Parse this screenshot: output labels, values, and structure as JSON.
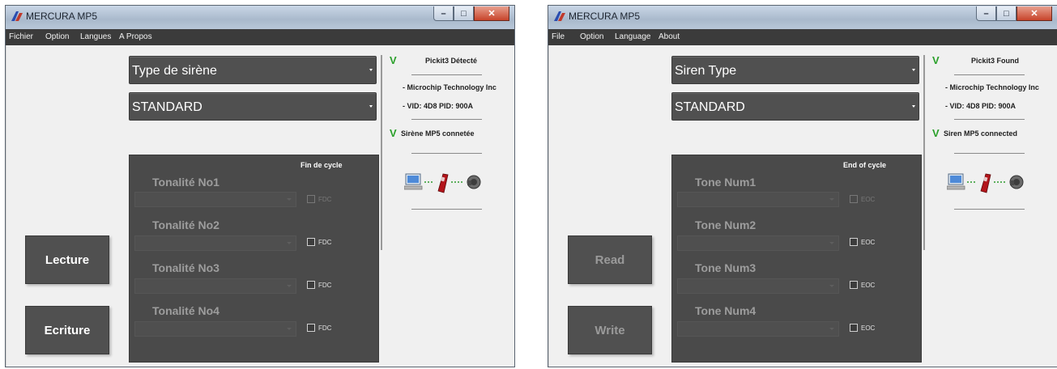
{
  "windows": [
    {
      "title": "MERCURA MP5",
      "menu": [
        "Fichier",
        "Option",
        "Langues",
        "A Propos"
      ],
      "siren_type": "Type de sirène",
      "siren_model": "STANDARD",
      "end_of_cycle_header": "Fin de cycle",
      "tones": [
        {
          "label": "Tonalité No1",
          "check_label": "FDC"
        },
        {
          "label": "Tonalité No2",
          "check_label": "FDC"
        },
        {
          "label": "Tonalité No3",
          "check_label": "FDC"
        },
        {
          "label": "Tonalité No4",
          "check_label": "FDC"
        }
      ],
      "read_button": "Lecture",
      "write_button": "Ecriture",
      "buttons_enabled": true,
      "status": {
        "check_mark": "V",
        "pickit": "Pickit3 Détecté",
        "manufacturer": "- Microchip Technology Inc",
        "vid_pid": "- VID: 4D8 PID: 900A",
        "siren": "Sirène MP5 connetée"
      }
    },
    {
      "title": "MERCURA MP5",
      "menu": [
        "File",
        "Option",
        "Language",
        "About"
      ],
      "siren_type": "Siren Type",
      "siren_model": "STANDARD",
      "end_of_cycle_header": "End of cycle",
      "tones": [
        {
          "label": "Tone Num1",
          "check_label": "EOC"
        },
        {
          "label": "Tone Num2",
          "check_label": "EOC"
        },
        {
          "label": "Tone Num3",
          "check_label": "EOC"
        },
        {
          "label": "Tone Num4",
          "check_label": "EOC"
        }
      ],
      "read_button": "Read",
      "write_button": "Write",
      "buttons_enabled": false,
      "status": {
        "check_mark": "V",
        "pickit": "Pickit3 Found",
        "manufacturer": "- Microchip Technology Inc",
        "vid_pid": "- VID: 4D8 PID: 900A",
        "siren": "Siren MP5 connected"
      }
    }
  ],
  "colors": {
    "menubar": "#3b3b3b",
    "panel": "#4a4a4a",
    "button": "#505050",
    "check_mark": "#2aa02a"
  },
  "icons": [
    "app-icon",
    "minimize-icon",
    "maximize-icon",
    "close-icon",
    "computer-icon",
    "programmer-icon",
    "siren-icon"
  ]
}
